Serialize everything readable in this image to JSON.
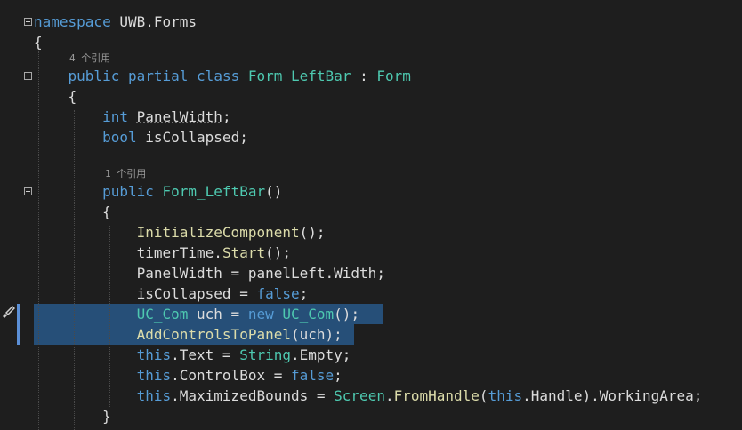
{
  "code": {
    "namespace_kw": "namespace",
    "namespace_name": "UWB.Forms",
    "open_brace": "{",
    "close_brace": "}",
    "refs_class": "4 个引用",
    "refs_ctor": "1 个引用",
    "class_public": "public",
    "class_partial": "partial",
    "class_kw": "class",
    "class_name": "Form_LeftBar",
    "class_colon": " : ",
    "class_base": "Form",
    "field1_type": "int",
    "field1_name": "PanelWidth",
    "field1_end": ";",
    "field2_type": "bool",
    "field2_name": "isCollapsed;",
    "ctor_public": "public",
    "ctor_name": "Form_LeftBar",
    "ctor_parens": "()",
    "l1_fn": "InitializeComponent",
    "l1_end": "();",
    "l2_obj": "timerTime",
    "l2_dot": ".",
    "l2_fn": "Start",
    "l2_end": "();",
    "l3_text": "PanelWidth = panelLeft.Width;",
    "l4_text": "isCollapsed = ",
    "l4_kw": "false",
    "l4_end": ";",
    "l5_type": "UC_Com",
    "l5_mid": " uch = ",
    "l5_new": "new",
    "l5_type2": "UC_Com",
    "l5_end": "();",
    "l6_fn": "AddControlsToPanel",
    "l6_end": "(uch);",
    "l7_this": "this",
    "l7_mid": ".Text = ",
    "l7_type": "String",
    "l7_end": ".Empty;",
    "l8_this": "this",
    "l8_mid": ".ControlBox = ",
    "l8_kw": "false",
    "l8_end": ";",
    "l9_this": "this",
    "l9_mid": ".MaximizedBounds = ",
    "l9_type": "Screen",
    "l9_dot": ".",
    "l9_fn": "FromHandle",
    "l9_p": "(",
    "l9_this2": "this",
    "l9_end": ".Handle).WorkingArea;"
  }
}
